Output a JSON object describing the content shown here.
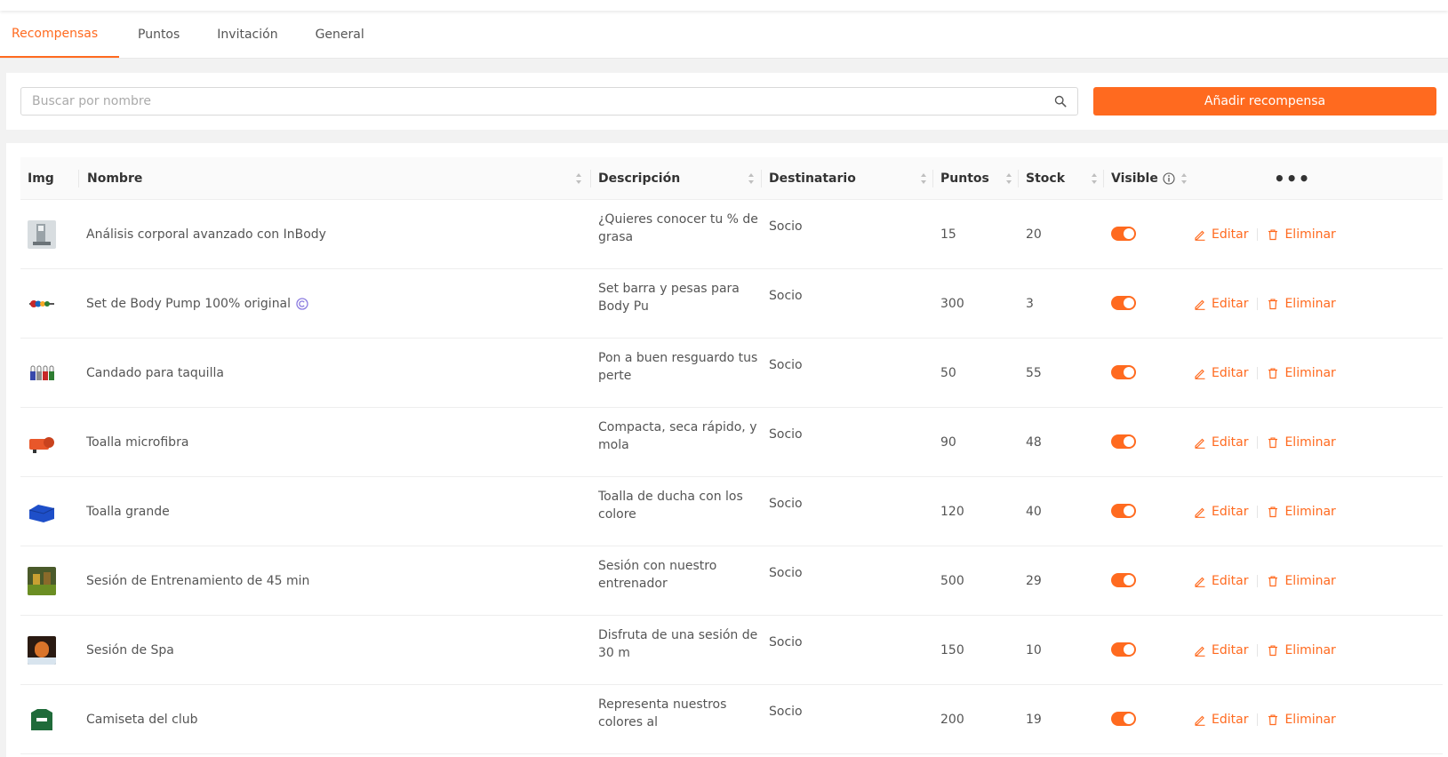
{
  "tabs": [
    "Recompensas",
    "Puntos",
    "Invitación",
    "General"
  ],
  "search": {
    "placeholder": "Buscar por nombre"
  },
  "add_button": "Añadir recompensa",
  "columns": {
    "img": "Img",
    "name": "Nombre",
    "desc": "Descripción",
    "dest": "Destinatario",
    "points": "Puntos",
    "stock": "Stock",
    "visible": "Visible",
    "more": "•••"
  },
  "actions": {
    "edit": "Editar",
    "delete": "Eliminar"
  },
  "colors": {
    "accent": "#ff6a1f"
  },
  "rows": [
    {
      "name": "Análisis corporal avanzado con InBody",
      "desc": "¿Quieres conocer tu % de grasa",
      "dest": "Socio",
      "points": "15",
      "stock": "20",
      "visible": true,
      "thumb": "inbody"
    },
    {
      "name": "Set de Body Pump 100% original",
      "desc": "Set barra y pesas para Body Pu",
      "dest": "Socio",
      "points": "300",
      "stock": "3",
      "visible": true,
      "thumb": "bodypump",
      "badge": "copyright-icon"
    },
    {
      "name": "Candado para taquilla",
      "desc": "Pon a buen resguardo tus perte",
      "dest": "Socio",
      "points": "50",
      "stock": "55",
      "visible": true,
      "thumb": "padlock"
    },
    {
      "name": "Toalla microfibra",
      "desc": "Compacta, seca rápido, y mola",
      "dest": "Socio",
      "points": "90",
      "stock": "48",
      "visible": true,
      "thumb": "towel-orange"
    },
    {
      "name": "Toalla grande",
      "desc": "Toalla de ducha con los colore",
      "dest": "Socio",
      "points": "120",
      "stock": "40",
      "visible": true,
      "thumb": "towel-blue"
    },
    {
      "name": "Sesión de Entrenamiento de 45 min",
      "desc": "Sesión con nuestro entrenador",
      "dest": "Socio",
      "points": "500",
      "stock": "29",
      "visible": true,
      "thumb": "gym"
    },
    {
      "name": "Sesión de Spa",
      "desc": "Disfruta de una sesión de 30 m",
      "dest": "Socio",
      "points": "150",
      "stock": "10",
      "visible": true,
      "thumb": "spa"
    },
    {
      "name": "Camiseta del club",
      "desc": "Representa nuestros colores al",
      "dest": "Socio",
      "points": "200",
      "stock": "19",
      "visible": true,
      "thumb": "shirt"
    }
  ]
}
